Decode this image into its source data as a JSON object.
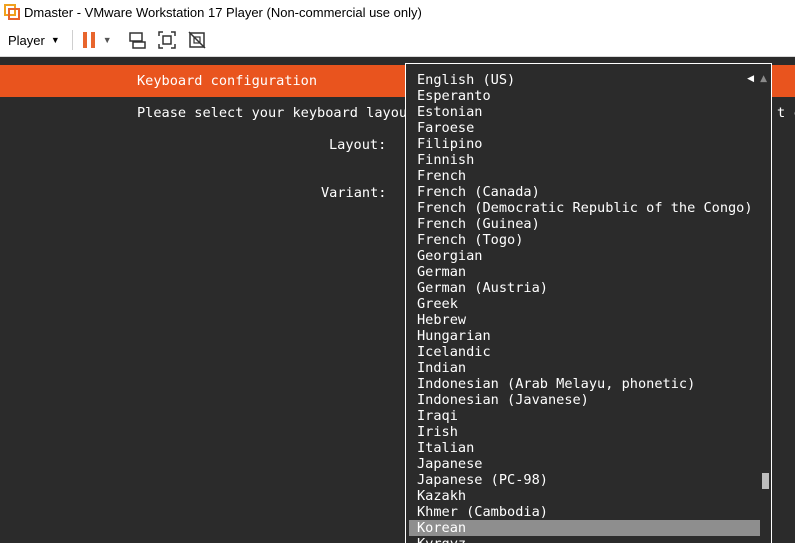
{
  "window": {
    "title": "Dmaster - VMware Workstation 17 Player (Non-commercial use only)",
    "app_icon": "vmware-icon"
  },
  "toolbar": {
    "player_menu_label": "Player",
    "accent_color": "#e8652d",
    "icons": [
      "pause-icon",
      "send-ctrl-alt-del-icon",
      "fullscreen-icon",
      "unity-icon"
    ]
  },
  "installer": {
    "header_title": "Keyboard configuration",
    "header_color": "#e9541e",
    "intro_text": "Please select your keyboard layou",
    "intro_tail": "t c",
    "layout_label": "Layout:",
    "variant_label": "Variant:",
    "dropdown": {
      "selected": "Korean",
      "items": [
        "English (US)",
        "Esperanto",
        "Estonian",
        "Faroese",
        "Filipino",
        "Finnish",
        "French",
        "French (Canada)",
        "French (Democratic Republic of the Congo)",
        "French (Guinea)",
        "French (Togo)",
        "Georgian",
        "German",
        "German (Austria)",
        "Greek",
        "Hebrew",
        "Hungarian",
        "Icelandic",
        "Indian",
        "Indonesian (Arab Melayu, phonetic)",
        "Indonesian (Javanese)",
        "Iraqi",
        "Irish",
        "Italian",
        "Japanese",
        "Japanese (PC-98)",
        "Kazakh",
        "Khmer (Cambodia)",
        "Korean",
        "Kyrgyz"
      ]
    }
  }
}
